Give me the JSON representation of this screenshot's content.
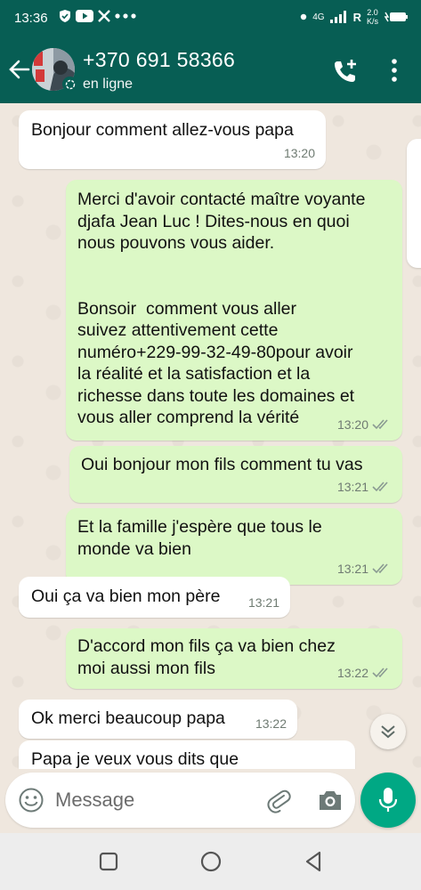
{
  "status_bar": {
    "time": "13:36",
    "network": "4G",
    "carrier_flag": "R",
    "speed_value": "2.0",
    "speed_unit": "K/s"
  },
  "header": {
    "contact_name": "+370 691 58366",
    "contact_status": "en ligne"
  },
  "messages": [
    {
      "direction": "in",
      "text": "Bonjour comment allez-vous papa",
      "time": "13:20"
    },
    {
      "direction": "out",
      "text": "Merci d'avoir contacté maître voyante\ndjafa Jean Luc ! Dites-nous en quoi\nnous pouvons vous aider.\n\n\nBonsoir  comment vous aller\nsuivez attentivement cette\nnuméro+229-99-32-49-80pour avoir\nla réalité et la satisfaction et la\nrichesse dans toute les domaines et\nvous aller comprend la vérité",
      "time": "13:20",
      "status": "read"
    },
    {
      "direction": "out",
      "text": "Oui bonjour mon fils comment tu vas",
      "time": "13:21",
      "status": "read"
    },
    {
      "direction": "out",
      "text": "Et la famille j'espère que tous le\nmonde va bien",
      "time": "13:21",
      "status": "read"
    },
    {
      "direction": "in",
      "text": "Oui ça va bien mon père",
      "time": "13:21"
    },
    {
      "direction": "out",
      "text": "D'accord mon fils ça va bien chez\nmoi aussi mon fils",
      "time": "13:22",
      "status": "read"
    },
    {
      "direction": "in",
      "text": "Ok merci beaucoup papa",
      "time": "13:22"
    },
    {
      "direction": "in",
      "text": "Papa je veux vous dits que",
      "time": ""
    }
  ],
  "composer": {
    "placeholder": "Message"
  },
  "colors": {
    "header": "#075e54",
    "outgoing_bubble": "#dcf8c6",
    "incoming_bubble": "#ffffff",
    "mic_button": "#00a884",
    "wallpaper": "#efe7de"
  },
  "icons": {
    "status_bar": [
      "shield-icon",
      "youtube-icon",
      "x-icon",
      "more-dots-icon",
      "dot-icon",
      "signal-icon",
      "battery-icon"
    ],
    "header": [
      "back-arrow-icon",
      "add-call-icon",
      "more-vert-icon"
    ],
    "composer": [
      "emoji-icon",
      "attach-icon",
      "camera-icon",
      "mic-icon"
    ],
    "nav": [
      "recent-apps-icon",
      "home-icon",
      "back-icon"
    ]
  }
}
